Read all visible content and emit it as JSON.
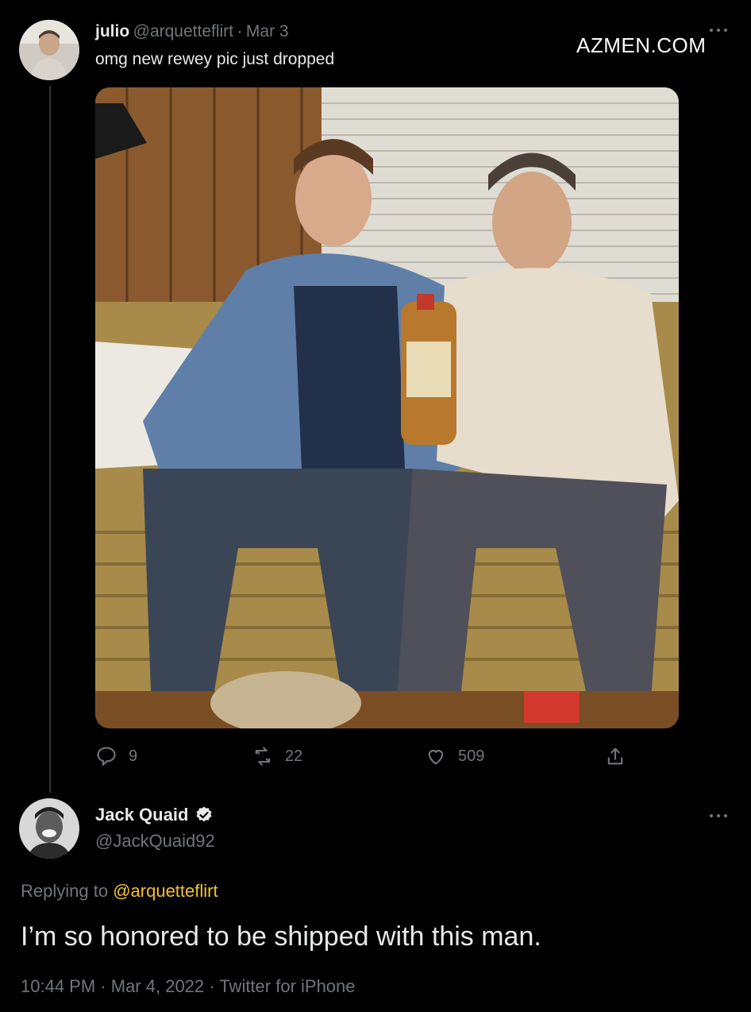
{
  "watermark": "AZMEN.COM",
  "original_tweet": {
    "author_name": "julio",
    "handle": "@arquetteflirt",
    "separator": "·",
    "date": "Mar 3",
    "text": "omg new rewey pic just dropped",
    "more_icon": "more-icon",
    "actions": {
      "replies": "9",
      "retweets": "22",
      "likes": "509"
    }
  },
  "reply_tweet": {
    "author_name": "Jack Quaid",
    "handle": "@JackQuaid92",
    "verified": true,
    "replying_prefix": "Replying to",
    "replying_to": "@arquetteflirt",
    "text": "I’m so honored to be shipped with this man.",
    "time": "10:44 PM",
    "separator": "·",
    "date": "Mar 4, 2022",
    "separator2": "·",
    "client": "Twitter for iPhone"
  },
  "colors": {
    "background": "#000000",
    "text": "#e7e9ea",
    "muted": "#71767b",
    "link": "#f5c22f",
    "verified": "#e7e9ea"
  }
}
